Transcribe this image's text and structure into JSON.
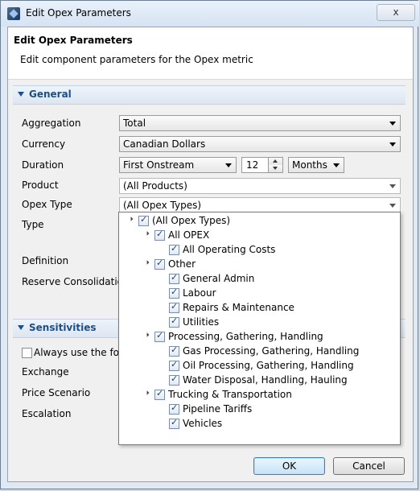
{
  "window": {
    "title": "Edit Opex Parameters",
    "close_glyph": "x"
  },
  "dialog": {
    "title": "Edit Opex Parameters",
    "subtitle": "Edit component parameters for the Opex metric"
  },
  "general": {
    "section_label": "General",
    "aggregation": {
      "label": "Aggregation",
      "value": "Total"
    },
    "currency": {
      "label": "Currency",
      "value": "Canadian Dollars"
    },
    "duration": {
      "label": "Duration",
      "value": "First Onstream",
      "number": "12",
      "unit": "Months"
    },
    "product": {
      "label": "Product",
      "value": "(All Products)"
    },
    "opex_type": {
      "label": "Opex Type",
      "value": "(All Opex Types)"
    },
    "type": {
      "label": "Type"
    },
    "definition": {
      "label": "Definition"
    },
    "reserve_consolidation": {
      "label": "Reserve Consolidation"
    }
  },
  "sensitivities": {
    "section_label": "Sensitivities",
    "always_use_label": "Always use the follo",
    "exchange_label": "Exchange",
    "price_scenario_label": "Price Scenario",
    "escalation_label": "Escalation"
  },
  "opex_tree": [
    {
      "label": "(All Opex Types)",
      "level": 0,
      "expanded": true,
      "checked": true
    },
    {
      "label": "All OPEX",
      "level": 1,
      "expanded": true,
      "checked": true
    },
    {
      "label": "All Operating Costs",
      "level": 2,
      "expanded": false,
      "checked": true
    },
    {
      "label": "Other",
      "level": 1,
      "expanded": true,
      "checked": true
    },
    {
      "label": "General Admin",
      "level": 2,
      "expanded": false,
      "checked": true
    },
    {
      "label": "Labour",
      "level": 2,
      "expanded": false,
      "checked": true
    },
    {
      "label": "Repairs & Maintenance",
      "level": 2,
      "expanded": false,
      "checked": true
    },
    {
      "label": "Utilities",
      "level": 2,
      "expanded": false,
      "checked": true
    },
    {
      "label": "Processing, Gathering, Handling",
      "level": 1,
      "expanded": true,
      "checked": true
    },
    {
      "label": "Gas Processing, Gathering, Handling",
      "level": 2,
      "expanded": false,
      "checked": true
    },
    {
      "label": "Oil Processing, Gathering, Handling",
      "level": 2,
      "expanded": false,
      "checked": true
    },
    {
      "label": "Water Disposal, Handling, Hauling",
      "level": 2,
      "expanded": false,
      "checked": true
    },
    {
      "label": "Trucking & Transportation",
      "level": 1,
      "expanded": true,
      "checked": true
    },
    {
      "label": "Pipeline Tariffs",
      "level": 2,
      "expanded": false,
      "checked": true
    },
    {
      "label": "Vehicles",
      "level": 2,
      "expanded": false,
      "checked": true
    }
  ],
  "buttons": {
    "ok": "OK",
    "cancel": "Cancel"
  }
}
